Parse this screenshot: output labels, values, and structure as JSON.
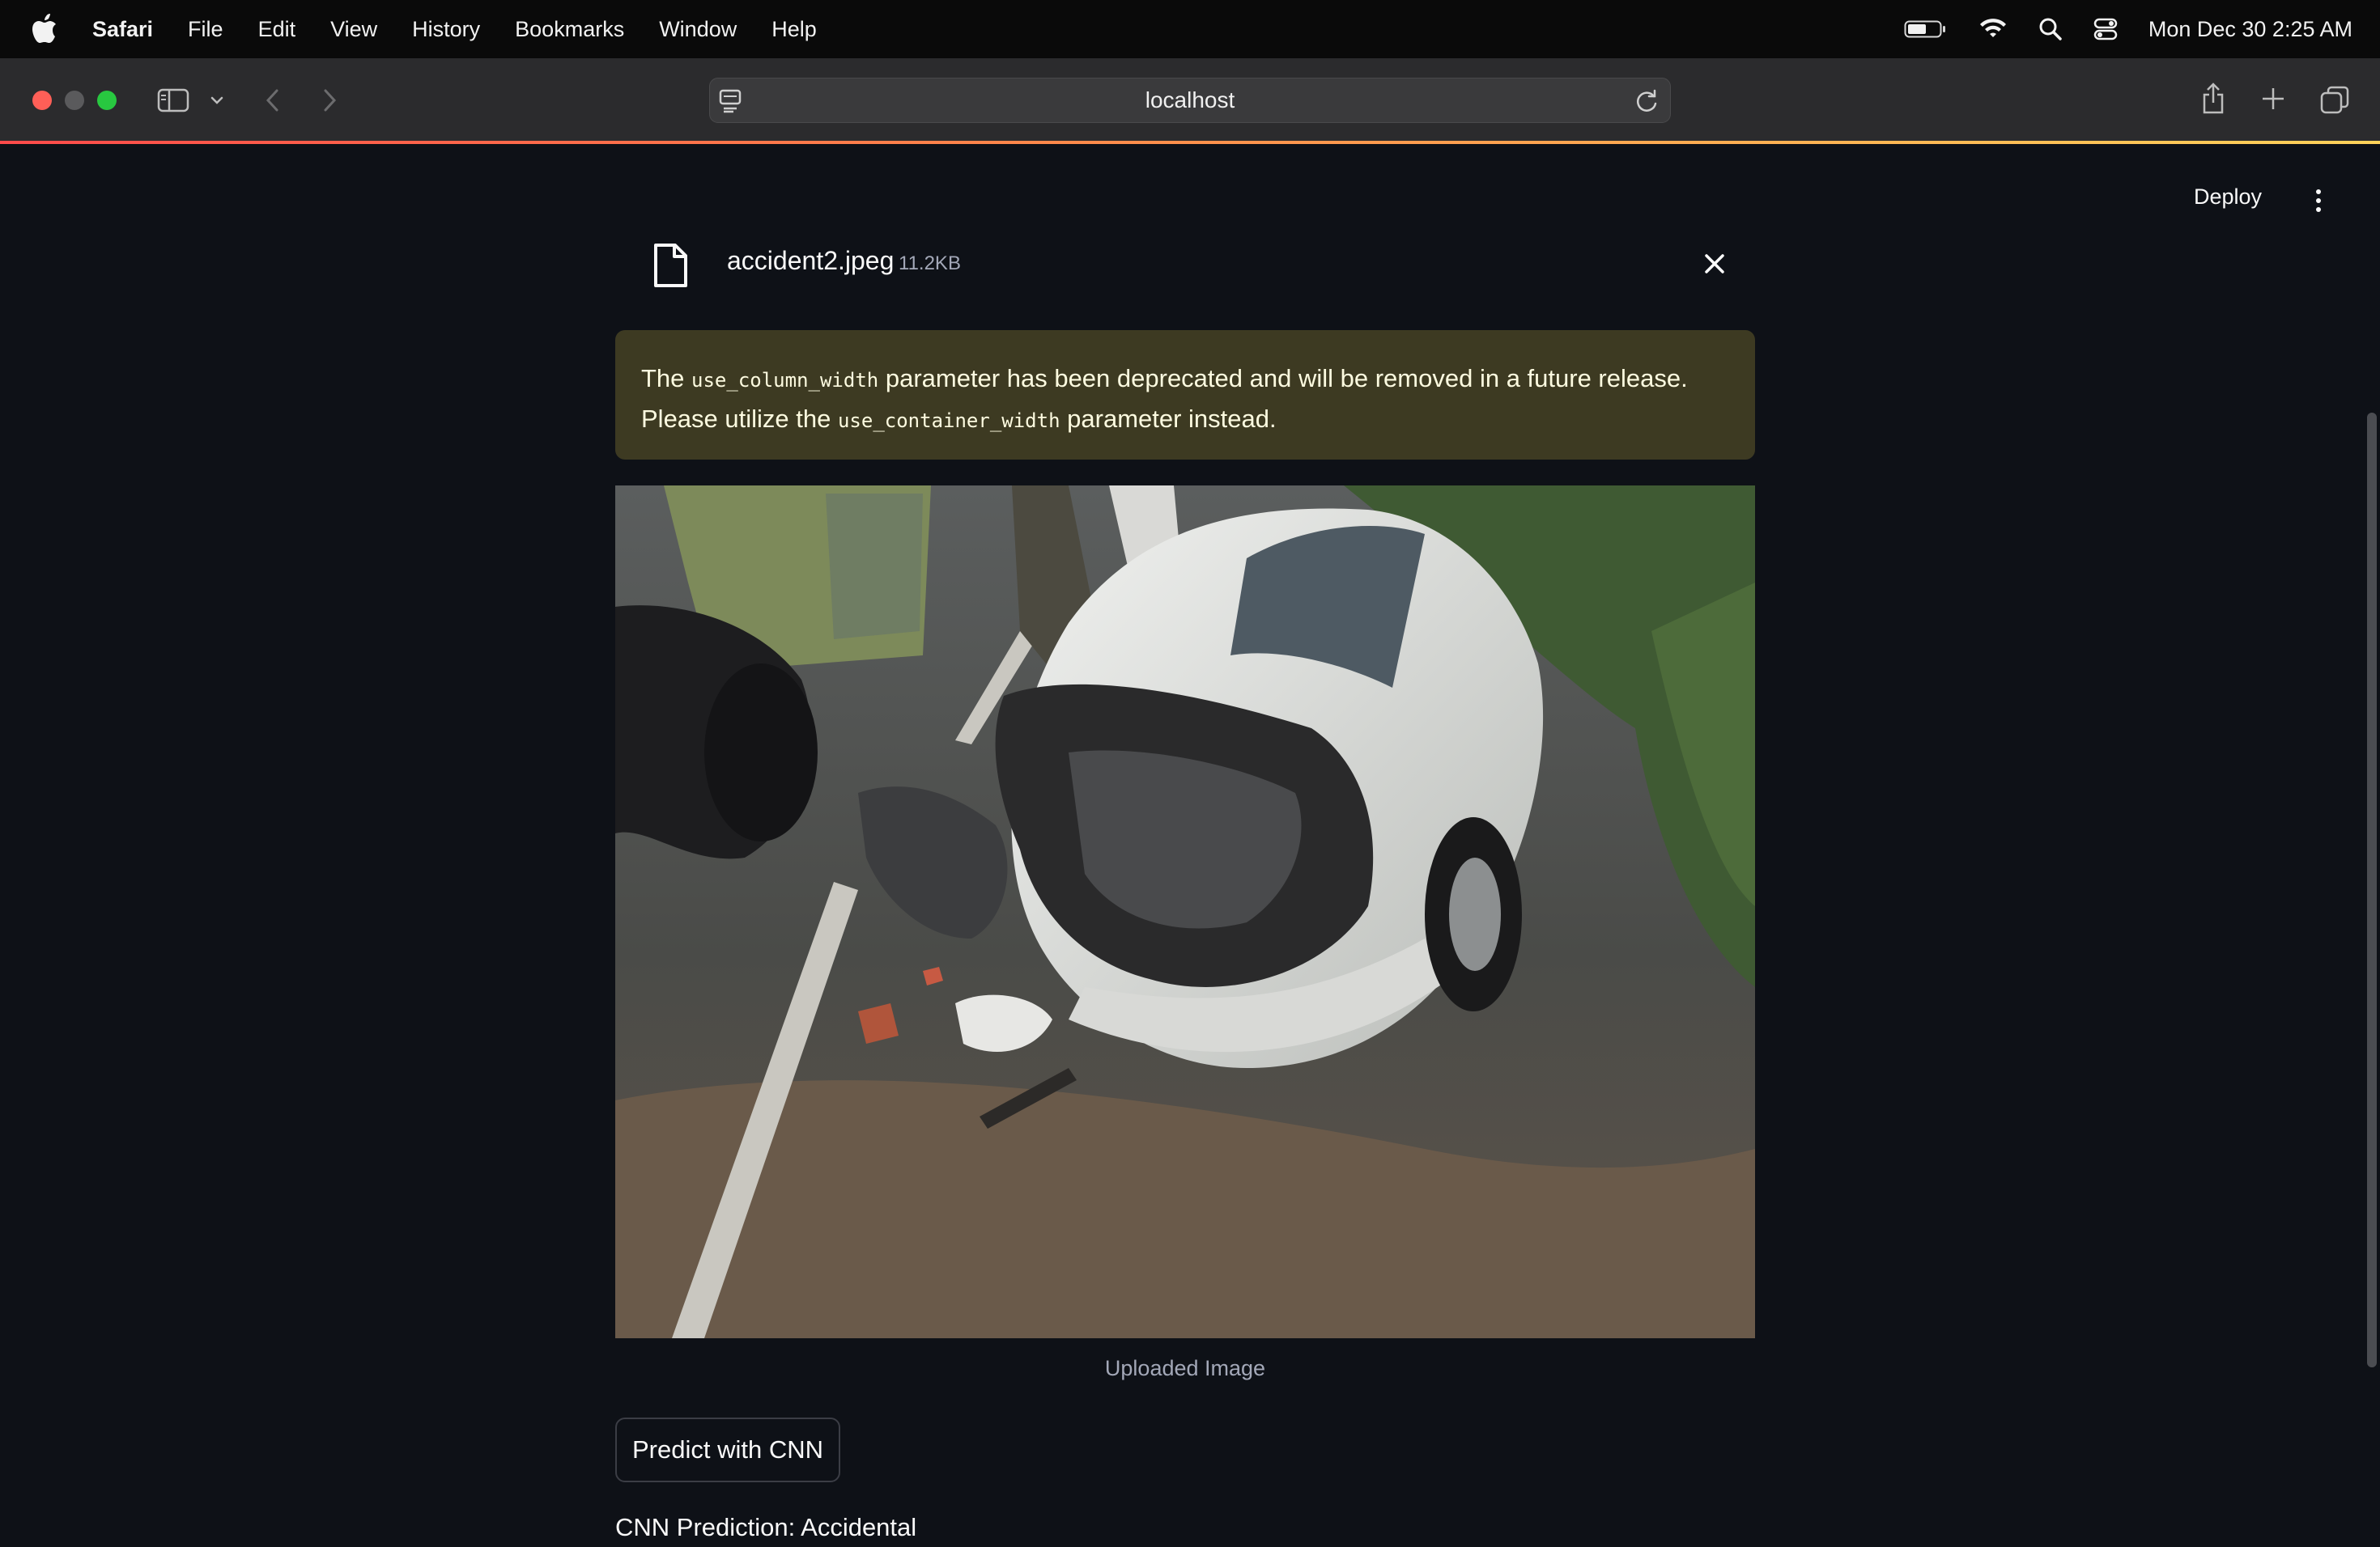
{
  "menubar": {
    "app_name": "Safari",
    "items": [
      "File",
      "Edit",
      "View",
      "History",
      "Bookmarks",
      "Window",
      "Help"
    ],
    "clock": "Mon Dec 30  2:25 AM",
    "status_icons": [
      "battery-icon",
      "wifi-icon",
      "spotlight-search-icon",
      "control-center-icon"
    ]
  },
  "browser": {
    "url": "localhost",
    "traffic_light_colors": [
      "#ff5f57",
      "#5a5a5c",
      "#28c840"
    ]
  },
  "app": {
    "deploy_label": "Deploy",
    "uploaded_file": {
      "name": "accident2.jpeg",
      "size": "11.2KB"
    },
    "warning": {
      "part1": "The ",
      "code1": "use_column_width",
      "part2": " parameter has been deprecated and will be removed in a future release. Please utilize the ",
      "code2": "use_container_width",
      "part3": " parameter instead."
    },
    "image_caption": "Uploaded Image",
    "predict_button_label": "Predict with CNN",
    "prediction_text": "CNN Prediction: Accidental"
  },
  "colors": {
    "background": "#0e1117",
    "warning_bg": "#3d3a22",
    "warning_text": "#fdfbe0",
    "accent_gradient": [
      "#ff4b4b",
      "#ffd35a"
    ]
  }
}
